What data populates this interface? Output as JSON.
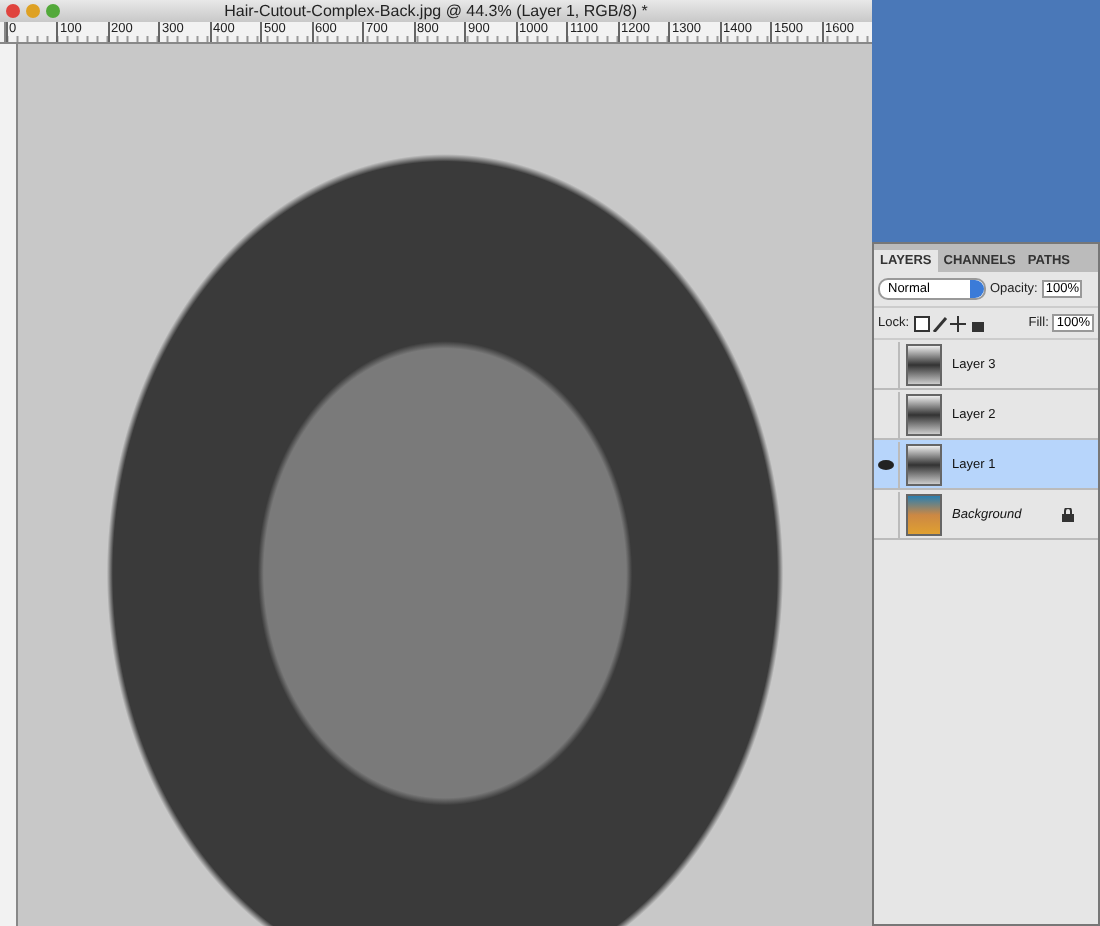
{
  "document": {
    "title": "Hair-Cutout-Complex-Back.jpg @ 44.3% (Layer 1, RGB/8) *",
    "ruler_labels": [
      "0",
      "100",
      "200",
      "300",
      "400",
      "500",
      "600",
      "700",
      "800",
      "900",
      "1000",
      "1100",
      "1200",
      "1300",
      "1400",
      "1500",
      "1600"
    ]
  },
  "layers_panel": {
    "tabs": [
      {
        "label": "LAYERS",
        "selected": true
      },
      {
        "label": "CHANNELS",
        "selected": false
      },
      {
        "label": "PATHS",
        "selected": false
      }
    ],
    "blend_mode": "Normal",
    "opacity_label": "Opacity:",
    "opacity": "100%",
    "lock_label": "Lock:",
    "fill_label": "Fill:",
    "fill": "100%",
    "layers": [
      {
        "name": "Layer 3",
        "visible": false,
        "selected": false,
        "kind": "layer"
      },
      {
        "name": "Layer 2",
        "visible": false,
        "selected": false,
        "kind": "layer"
      },
      {
        "name": "Layer 1",
        "visible": true,
        "selected": true,
        "kind": "layer"
      },
      {
        "name": "Background",
        "visible": false,
        "selected": false,
        "kind": "background"
      }
    ]
  }
}
